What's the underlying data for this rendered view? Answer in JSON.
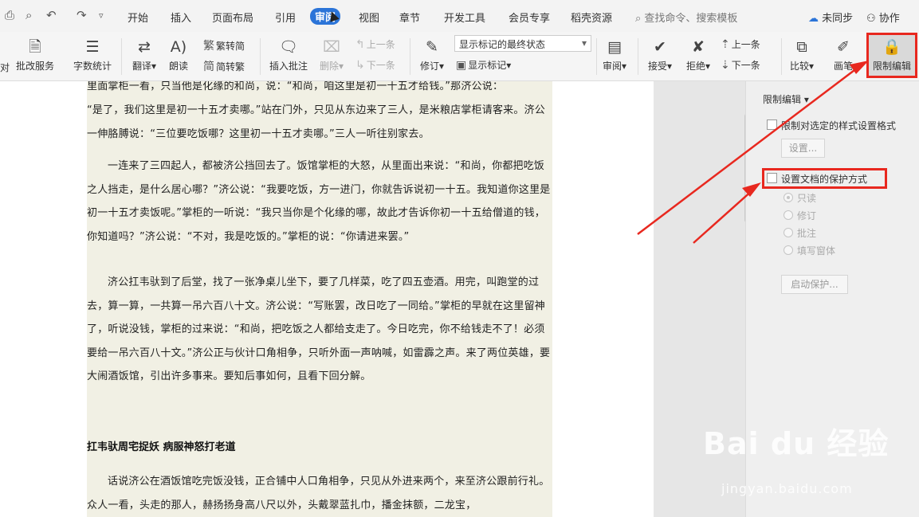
{
  "menubar": {
    "items": [
      "开始",
      "插入",
      "页面布局",
      "引用",
      "审阅",
      "视图",
      "章节",
      "开发工具",
      "会员专享",
      "稻壳资源"
    ],
    "active": "审阅",
    "search_placeholder": "查找命令、搜索模板",
    "sync": "未同步",
    "collab": "协作"
  },
  "ribbon": {
    "cut_label": "对",
    "correct_service": "批改服务",
    "word_count": "字数统计",
    "translate": "翻译",
    "read_aloud": "朗读",
    "trad_convert": "繁转简",
    "simp_convert": "简转繁",
    "insert_comment": "插入批注",
    "delete": "删除",
    "prev_comment": "上一条",
    "next_comment": "下一条",
    "revise": "修订",
    "display_select": "显示标记的最终状态",
    "show_marks": "显示标记",
    "review": "审阅",
    "accept": "接受",
    "reject": "拒绝",
    "prev_change": "上一条",
    "next_change": "下一条",
    "compare": "比较",
    "pen": "画笔",
    "restrict_edit": "限制编辑"
  },
  "document": {
    "paragraphs": [
      "里面掌柜一看，只当他是化缘的和尚，说：“和尚，咱这里是初一十五才给钱。”那济公说：",
      "“是了，我们这里是初一十五才卖哪。”站在门外，只见从东边来了三人，是米粮店掌柜请客来。济公一伸胳膊说：“三位要吃饭哪？这里初一十五才卖哪。”三人一听往别家去。",
      "一连来了三四起人，都被济公挡回去了。饭馆掌柜的大怒，从里面出来说：“和尚，你都把吃饭之人挡走，是什么居心哪？”济公说：“我要吃饭，方一进门，你就告诉说初一十五。我知道你这里是初一十五才卖饭呢。”掌柜的一听说：“我只当你是个化缘的哪，故此才告诉你初一十五给僧道的钱，你知道吗？”济公说：“不对，我是吃饭的。”掌柜的说：“你请进来罢。”",
      "济公扛韦驮到了后堂，找了一张净桌儿坐下，要了几样菜，吃了四五壶酒。用完，叫跑堂的过去，算一算，一共算一吊六百八十文。济公说：“写账罢，改日吃了一同给。”掌柜的早就在这里留神了，听说没钱，掌柜的过来说：“和尚，把吃饭之人都给支走了。今日吃完，你不给钱走不了！必须要给一吊六百八十文。”济公正与伙计口角相争，只听外面一声呐喊，如雷霹之声。来了两位英雄，要大闹酒饭馆，引出许多事来。要知后事如何，且看下回分解。",
      "话说济公在酒饭馆吃完饭没钱，正合铺中人口角相争，只见从外进来两个，来至济公跟前行礼。众人一看，头走的那人，赫扬扬身高八尺以外，头戴翠蓝扎巾，播金抹额，二龙宝，"
    ],
    "heading": "扛韦驮周宅捉妖 病服神怒打老道"
  },
  "pane": {
    "title": "限制编辑",
    "option1": "限制对选定的样式设置格式",
    "settings_btn": "设置...",
    "option2": "设置文档的保护方式",
    "radios": [
      "只读",
      "修订",
      "批注",
      "填写窗体"
    ],
    "start_btn": "启动保护..."
  },
  "watermark": {
    "brand": "Bai du 经验",
    "url": "jingyan.baidu.com"
  },
  "annotation_color": "#e8281f"
}
